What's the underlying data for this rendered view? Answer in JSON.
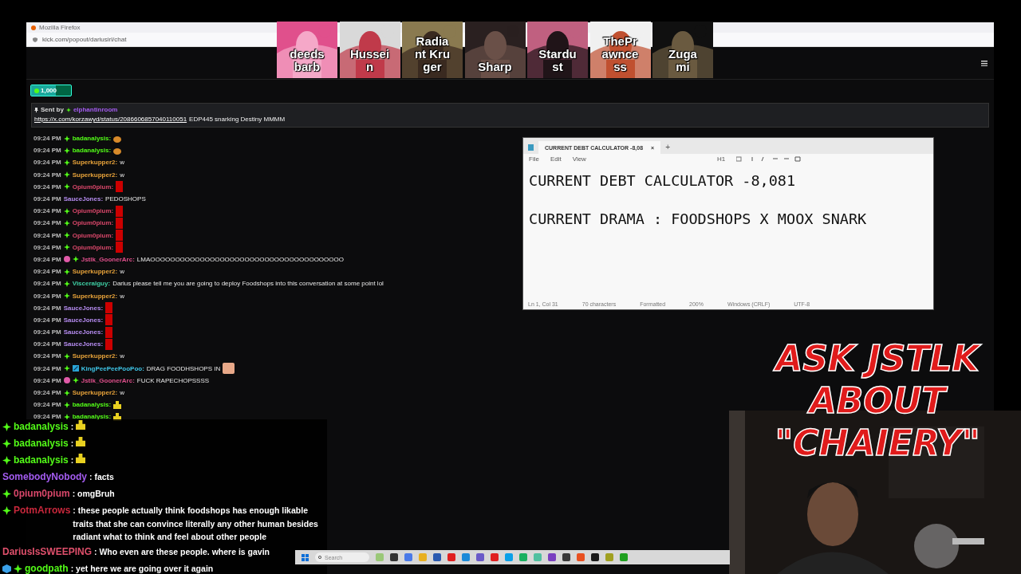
{
  "browser": {
    "title": "Mozilla Firefox",
    "url": "kick.com/popout/dariusirl/chat"
  },
  "participants": [
    {
      "lines": [
        "deeds",
        "barb"
      ]
    },
    {
      "lines": [
        "Hussei",
        "n"
      ]
    },
    {
      "lines": [
        "Radia",
        "nt Kru",
        "ger"
      ]
    },
    {
      "lines": [
        "Sharp"
      ]
    },
    {
      "lines": [
        "Stardu",
        "st"
      ]
    },
    {
      "lines": [
        "ThePr",
        "awnce",
        "ss"
      ]
    },
    {
      "lines": [
        "Zuga",
        "mi"
      ]
    }
  ],
  "goal": {
    "amount": "1,000",
    "level": 0.62
  },
  "pinned": {
    "label": "Sent by",
    "user": "elphantinroom",
    "link": "https://x.com/korzawyd/status/2086606857040110051",
    "text": "EDP445 snarking Destiny MMMM"
  },
  "chat": [
    {
      "time": "09:24 PM",
      "badges": [
        {
          "kind": "verified"
        }
      ],
      "user": "badanalysis:",
      "color": "#53fc18",
      "emote": {
        "kind": "pumpkin"
      }
    },
    {
      "time": "09:24 PM",
      "badges": [
        {
          "kind": "verified"
        }
      ],
      "user": "badanalysis:",
      "color": "#53fc18",
      "emote": {
        "kind": "pumpkin"
      }
    },
    {
      "time": "09:24 PM",
      "badges": [
        {
          "kind": "verified"
        }
      ],
      "user": "Superkupper2:",
      "color": "#e8a33a",
      "text": "w"
    },
    {
      "time": "09:24 PM",
      "badges": [
        {
          "kind": "verified"
        }
      ],
      "user": "Superkupper2:",
      "color": "#e8a33a",
      "text": "w"
    },
    {
      "time": "09:24 PM",
      "badges": [
        {
          "kind": "verified"
        }
      ],
      "user": "Opium0pium:",
      "color": "#d9476a",
      "emote": {
        "kind": "block"
      }
    },
    {
      "time": "09:24 PM",
      "user": "SauceJones:",
      "color": "#b68cf0",
      "text": "PEDOSHOPS"
    },
    {
      "time": "09:24 PM",
      "badges": [
        {
          "kind": "verified"
        }
      ],
      "user": "Opium0pium:",
      "color": "#d9476a",
      "emote": {
        "kind": "block"
      }
    },
    {
      "time": "09:24 PM",
      "badges": [
        {
          "kind": "verified"
        }
      ],
      "user": "Opium0pium:",
      "color": "#d9476a",
      "emote": {
        "kind": "block"
      }
    },
    {
      "time": "09:24 PM",
      "badges": [
        {
          "kind": "verified"
        }
      ],
      "user": "Opium0pium:",
      "color": "#d9476a",
      "emote": {
        "kind": "block"
      }
    },
    {
      "time": "09:24 PM",
      "badges": [
        {
          "kind": "verified"
        }
      ],
      "user": "Opium0pium:",
      "color": "#d9476a",
      "emote": {
        "kind": "block"
      }
    },
    {
      "time": "09:24 PM",
      "badges": [
        {
          "kind": "sub"
        },
        {
          "kind": "verified"
        }
      ],
      "user": "Jstlk_GoonerArc:",
      "color": "#e0508c",
      "text": "LMAOOOOOOOOOOOOOOOOOOOOOOOOOOOOOOOOOOOOOOO"
    },
    {
      "time": "09:24 PM",
      "badges": [
        {
          "kind": "verified"
        }
      ],
      "user": "Superkupper2:",
      "color": "#e8a33a",
      "text": "w"
    },
    {
      "time": "09:24 PM",
      "badges": [
        {
          "kind": "verified"
        }
      ],
      "user": "Visceralguy:",
      "color": "#3fcfa4",
      "text": "Darius please tell me you are going to deploy Foodshops into this conversation at some point lol"
    },
    {
      "time": "09:24 PM",
      "badges": [
        {
          "kind": "verified"
        }
      ],
      "user": "Superkupper2:",
      "color": "#e8a33a",
      "text": "w"
    },
    {
      "time": "09:24 PM",
      "user": "SauceJones:",
      "color": "#b68cf0",
      "emote": {
        "kind": "block"
      }
    },
    {
      "time": "09:24 PM",
      "user": "SauceJones:",
      "color": "#b68cf0",
      "emote": {
        "kind": "block"
      }
    },
    {
      "time": "09:24 PM",
      "user": "SauceJones:",
      "color": "#b68cf0",
      "emote": {
        "kind": "block"
      }
    },
    {
      "time": "09:24 PM",
      "user": "SauceJones:",
      "color": "#b68cf0",
      "emote": {
        "kind": "block"
      }
    },
    {
      "time": "09:24 PM",
      "badges": [
        {
          "kind": "verified"
        }
      ],
      "user": "Superkupper2:",
      "color": "#e8a33a",
      "text": "w"
    },
    {
      "time": "09:24 PM",
      "badges": [
        {
          "kind": "verified"
        },
        {
          "kind": "mod"
        }
      ],
      "user": "KingPeePeePooPoo:",
      "color": "#3fc6e8",
      "text": "DRAG FOODHSHOPS IN",
      "emote": {
        "kind": "face"
      }
    },
    {
      "time": "09:24 PM",
      "badges": [
        {
          "kind": "sub"
        },
        {
          "kind": "verified"
        }
      ],
      "user": "Jstlk_GoonerArc:",
      "color": "#e0508c",
      "text": "FUCK RAPECHOPSSSS"
    },
    {
      "time": "09:24 PM",
      "badges": [
        {
          "kind": "verified"
        }
      ],
      "user": "Superkupper2:",
      "color": "#e8a33a",
      "text": "w"
    },
    {
      "time": "09:24 PM",
      "badges": [
        {
          "kind": "verified"
        }
      ],
      "user": "badanalysis:",
      "color": "#53fc18",
      "emote": {
        "kind": "duck"
      }
    },
    {
      "time": "09:24 PM",
      "badges": [
        {
          "kind": "verified"
        }
      ],
      "user": "badanalysis:",
      "color": "#53fc18",
      "emote": {
        "kind": "duck"
      }
    }
  ],
  "notepad": {
    "tab": "CURRENT DEBT CALCULATOR -8,08",
    "close": "×",
    "new_tab": "+",
    "menu": [
      "File",
      "Edit",
      "View"
    ],
    "heading": "H1",
    "lines": [
      "CURRENT DEBT CALCULATOR -8,081",
      "CURRENT DRAMA : FOODSHOPS X MOOX SNARK"
    ],
    "status": [
      "Ln 1, Col 31",
      "70 characters",
      "Formatted",
      "200%",
      "Windows (CRLF)",
      "UTF-8"
    ]
  },
  "banner": {
    "lines": [
      "ASK JSTLK",
      "ABOUT",
      "\"CHAIERY\""
    ]
  },
  "overlay_chat": [
    {
      "badges": [
        {
          "kind": "verified"
        }
      ],
      "user": "badanalysis",
      "color": "#53fc18",
      "text": ":",
      "emote": {
        "kind": "duck"
      }
    },
    {
      "badges": [
        {
          "kind": "verified"
        }
      ],
      "user": "badanalysis",
      "color": "#53fc18",
      "text": ":",
      "emote": {
        "kind": "duck"
      }
    },
    {
      "badges": [
        {
          "kind": "verified"
        }
      ],
      "user": "badanalysis",
      "color": "#53fc18",
      "text": ":",
      "emote": {
        "kind": "duck"
      }
    },
    {
      "user": "SomebodyNobody",
      "color": "#a45cf0",
      "text": ": facts"
    },
    {
      "badges": [
        {
          "kind": "verified"
        }
      ],
      "user": "0pium0pium",
      "color": "#d9476a",
      "text": ": omgBruh"
    },
    {
      "badges": [
        {
          "kind": "verified"
        }
      ],
      "user": "PotmArrows",
      "color": "#c8283c",
      "text": ": these people actually think foodshops has enough likable traits that she can convince literally any other human besides radiant what to think and feel about other people"
    },
    {
      "user": "DariusIsSWEEPING",
      "color": "#e0506c",
      "text": ": Who even are these people. where is gavin"
    },
    {
      "badges": [
        {
          "kind": "cube"
        },
        {
          "kind": "verified"
        }
      ],
      "user": "goodpath",
      "color": "#53fc18",
      "text": ": yet here we are going over it again"
    }
  ],
  "taskbar": {
    "search": "Search"
  }
}
